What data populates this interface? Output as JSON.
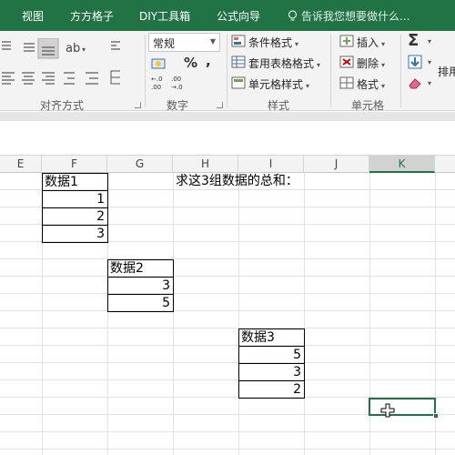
{
  "tabs": [
    "视图",
    "方方格子",
    "DIY工具箱",
    "公式向导"
  ],
  "tell_me": "告诉我您想要做什么...",
  "ribbon": {
    "alignment_label": "对齐方式",
    "number_label": "数字",
    "number_format": "常规",
    "styles_label": "样式",
    "conditional_format": "条件格式",
    "table_format": "套用表格格式",
    "cell_styles": "单元格样式",
    "cells_label": "单元格",
    "insert": "插入",
    "delete": "删除",
    "format": "格式",
    "sort_partial": "排用"
  },
  "columns": [
    "E",
    "F",
    "G",
    "H",
    "I",
    "J",
    "K"
  ],
  "active_column": "K",
  "cells": {
    "f_header": "数据1",
    "f1": "1",
    "f2": "2",
    "f3": "3",
    "instruction": "求这3组数据的总和：",
    "g_header": "数据2",
    "g1": "3",
    "g2": "5",
    "i_header": "数据3",
    "i1": "5",
    "i2": "3",
    "i3": "2"
  },
  "colors": {
    "accent": "#217346",
    "ribbon_bg": "#f3f3f3",
    "grid_line": "#e1e1e1"
  }
}
